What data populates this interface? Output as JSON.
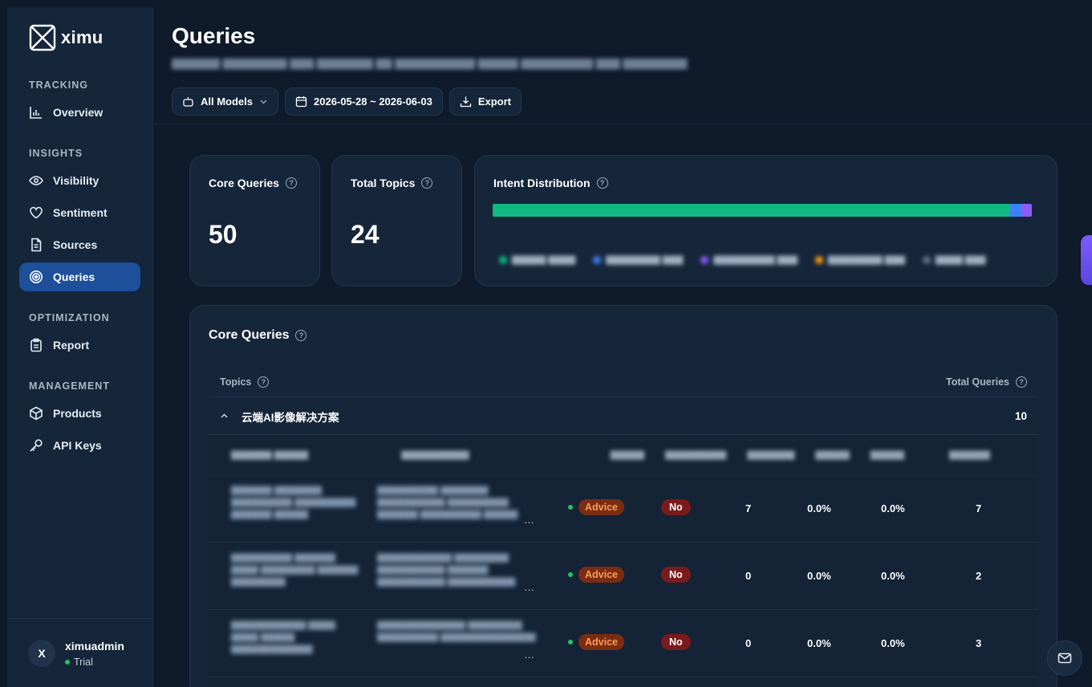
{
  "app": {
    "name": "ximu"
  },
  "sidebar": {
    "sections": [
      {
        "title": "TRACKING",
        "items": [
          {
            "label": "Overview",
            "icon": "bar-chart-icon"
          }
        ]
      },
      {
        "title": "INSIGHTS",
        "items": [
          {
            "label": "Visibility",
            "icon": "eye-icon"
          },
          {
            "label": "Sentiment",
            "icon": "heart-icon"
          },
          {
            "label": "Sources",
            "icon": "document-icon"
          },
          {
            "label": "Queries",
            "icon": "target-icon",
            "active": true
          }
        ]
      },
      {
        "title": "OPTIMIZATION",
        "items": [
          {
            "label": "Report",
            "icon": "clipboard-icon"
          }
        ]
      },
      {
        "title": "MANAGEMENT",
        "items": [
          {
            "label": "Products",
            "icon": "box-icon"
          },
          {
            "label": "API Keys",
            "icon": "key-icon"
          }
        ]
      }
    ],
    "user": {
      "initial": "X",
      "name": "ximuadmin",
      "plan": "Trial"
    }
  },
  "header": {
    "title": "Queries",
    "toolbar": {
      "models_label": "All Models",
      "date_range": "2026-05-28 ~ 2026-06-03",
      "export_label": "Export"
    }
  },
  "stats": {
    "core_queries": {
      "label": "Core Queries",
      "value": "50"
    },
    "total_topics": {
      "label": "Total Topics",
      "value": "24"
    },
    "intent": {
      "label": "Intent Distribution",
      "segments": [
        {
          "color": "#10b981",
          "share": 0.96
        },
        {
          "color": "#3b82f6",
          "share": 0.02
        },
        {
          "color": "#8b5cf6",
          "share": 0.02
        }
      ]
    }
  },
  "table": {
    "title": "Core Queries",
    "topics_header": "Topics",
    "total_header": "Total Queries",
    "topic": {
      "name": "云端AI影像解决方案",
      "total": "10"
    },
    "rows": [
      {
        "intent": "Advice",
        "mentioned": "No",
        "c1": "7",
        "c2": "0.0%",
        "c3": "0.0%",
        "c4": "7"
      },
      {
        "intent": "Advice",
        "mentioned": "No",
        "c1": "0",
        "c2": "0.0%",
        "c3": "0.0%",
        "c4": "2"
      },
      {
        "intent": "Advice",
        "mentioned": "No",
        "c1": "0",
        "c2": "0.0%",
        "c3": "0.0%",
        "c4": "3"
      }
    ]
  },
  "colors": {
    "accent": "#1d4f9a",
    "advice_bg": "#7a2d12",
    "no_bg": "#7a1a1d"
  }
}
